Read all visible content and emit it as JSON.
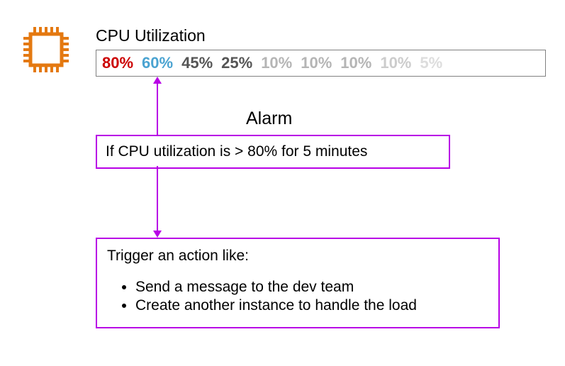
{
  "title": "CPU Utilization",
  "utilization": [
    {
      "value": "80%",
      "color": "#cc0000"
    },
    {
      "value": "60%",
      "color": "#4aa3d1"
    },
    {
      "value": "45%",
      "color": "#555555"
    },
    {
      "value": "25%",
      "color": "#555555"
    },
    {
      "value": "10%",
      "color": "#b5b5b5"
    },
    {
      "value": "10%",
      "color": "#b5b5b5"
    },
    {
      "value": "10%",
      "color": "#b5b5b5"
    },
    {
      "value": "10%",
      "color": "#cccccc"
    },
    {
      "value": "5%",
      "color": "#dddddd"
    }
  ],
  "alarm_label": "Alarm",
  "condition": "If CPU utilization is > 80% for 5 minutes",
  "action": {
    "intro": "Trigger an action like:",
    "items": [
      "Send a message to the dev team",
      "Create another instance to handle the load"
    ]
  }
}
